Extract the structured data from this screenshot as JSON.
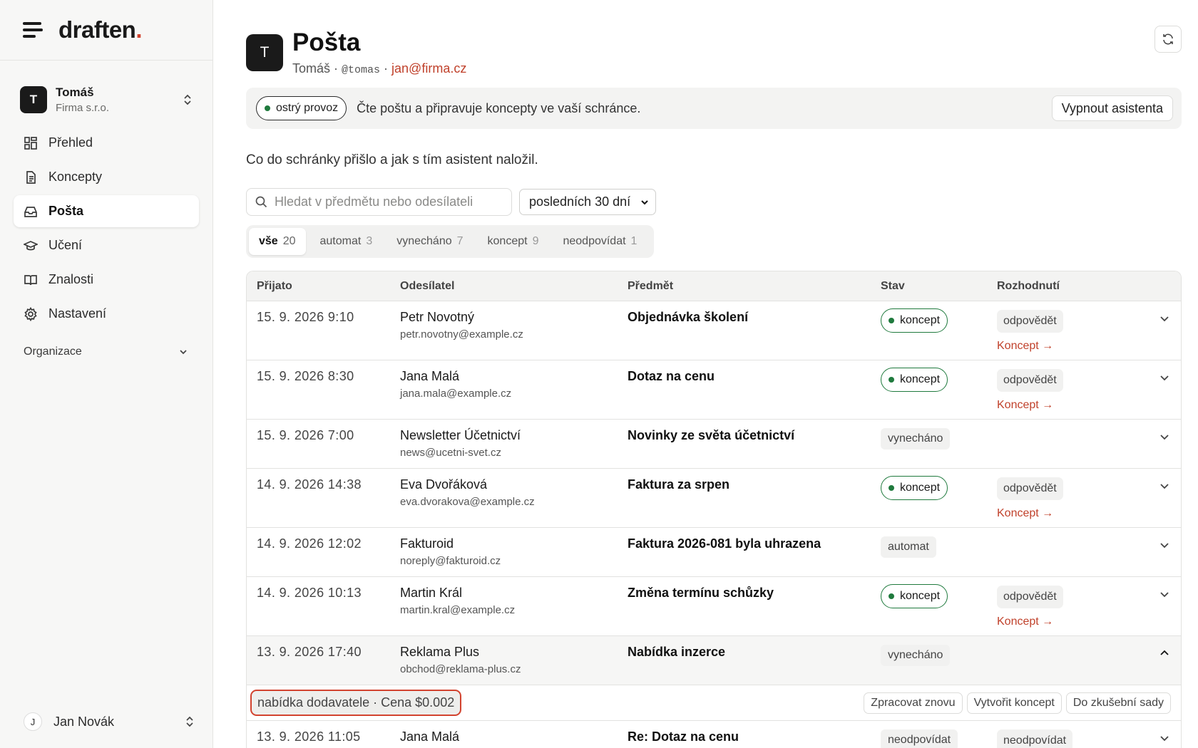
{
  "brand": {
    "name": "draften",
    "dot": "."
  },
  "org": {
    "initial": "T",
    "name": "Tomáš",
    "company": "Firma s.r.o."
  },
  "nav": [
    {
      "label": "Přehled",
      "icon": "grid-icon"
    },
    {
      "label": "Koncepty",
      "icon": "document-icon"
    },
    {
      "label": "Pošta",
      "icon": "inbox-icon",
      "active": true
    },
    {
      "label": "Učení",
      "icon": "graduation-cap-icon"
    },
    {
      "label": "Znalosti",
      "icon": "book-icon"
    },
    {
      "label": "Nastavení",
      "icon": "gear-icon"
    }
  ],
  "org_section": {
    "label": "Organizace"
  },
  "user": {
    "initial": "J",
    "name": "Jan Novák"
  },
  "page": {
    "avatar": "T",
    "title": "Pošta",
    "name": "Tomáš",
    "sep1": " · ",
    "handle": "@tomas",
    "sep2": " · ",
    "email": "jan@firma.cz"
  },
  "banner": {
    "status": "ostrý provoz",
    "text": "Čte poštu a připravuje koncepty ve vaší schránce.",
    "button": "Vypnout asistenta"
  },
  "intro": "Co do schránky přišlo a jak s tím asistent naložil.",
  "search": {
    "placeholder": "Hledat v předmětu nebo odesílateli",
    "value": ""
  },
  "period": {
    "selected": "posledních 30 dní"
  },
  "tabs": [
    {
      "label": "vše",
      "count": "20",
      "active": true
    },
    {
      "label": "automat",
      "count": "3"
    },
    {
      "label": "vynecháno",
      "count": "7"
    },
    {
      "label": "koncept",
      "count": "9"
    },
    {
      "label": "neodpovídat",
      "count": "1"
    }
  ],
  "columns": [
    "Přijato",
    "Odesílatel",
    "Předmět",
    "Stav",
    "Rozhodnutí"
  ],
  "rows": [
    {
      "date": "15. 9. 2026 9:10",
      "name": "Petr Novotný",
      "email": "petr.novotny@example.cz",
      "subject": "Objednávka školení",
      "status": "koncept",
      "status_style": "koncept",
      "decision": "odpovědět",
      "link": "Koncept →"
    },
    {
      "date": "15. 9. 2026 8:30",
      "name": "Jana Malá",
      "email": "jana.mala@example.cz",
      "subject": "Dotaz na cenu",
      "status": "koncept",
      "status_style": "koncept",
      "decision": "odpovědět",
      "link": "Koncept →"
    },
    {
      "date": "15. 9. 2026 7:00",
      "name": "Newsletter Účetnictví",
      "email": "news@ucetni-svet.cz",
      "subject": "Novinky ze světa účetnictví",
      "status": "vynecháno",
      "status_style": "gray",
      "decision": "",
      "link": ""
    },
    {
      "date": "14. 9. 2026 14:38",
      "name": "Eva Dvořáková",
      "email": "eva.dvorakova@example.cz",
      "subject": "Faktura za srpen",
      "status": "koncept",
      "status_style": "koncept",
      "decision": "odpovědět",
      "link": "Koncept →"
    },
    {
      "date": "14. 9. 2026 12:02",
      "name": "Fakturoid",
      "email": "noreply@fakturoid.cz",
      "subject": "Faktura 2026-081 byla uhrazena",
      "status": "automat",
      "status_style": "gray",
      "decision": "",
      "link": ""
    },
    {
      "date": "14. 9. 2026 10:13",
      "name": "Martin Král",
      "email": "martin.kral@example.cz",
      "subject": "Změna termínu schůzky",
      "status": "koncept",
      "status_style": "koncept",
      "decision": "odpovědět",
      "link": "Koncept →"
    },
    {
      "date": "13. 9. 2026 17:40",
      "name": "Reklama Plus",
      "email": "obchod@reklama-plus.cz",
      "subject": "Nabídka inzerce",
      "status": "vynecháno",
      "status_style": "gray",
      "decision": "",
      "link": "",
      "expanded": true
    },
    {
      "date": "13. 9. 2026 11:05",
      "name": "Jana Malá",
      "email": "",
      "subject": "Re: Dotaz na cenu",
      "status": "neodpovídat",
      "status_style": "gray",
      "decision": "neodpovídat",
      "link": ""
    }
  ],
  "expanded_detail": {
    "reason": "nabídka dodavatele · Cena $0.002",
    "actions": [
      "Zpracovat znovu",
      "Vytvořit koncept",
      "Do zkušební sady"
    ]
  },
  "colors": {
    "accent": "#d2432f",
    "link": "#c0412b",
    "green": "#1f7a3d"
  }
}
